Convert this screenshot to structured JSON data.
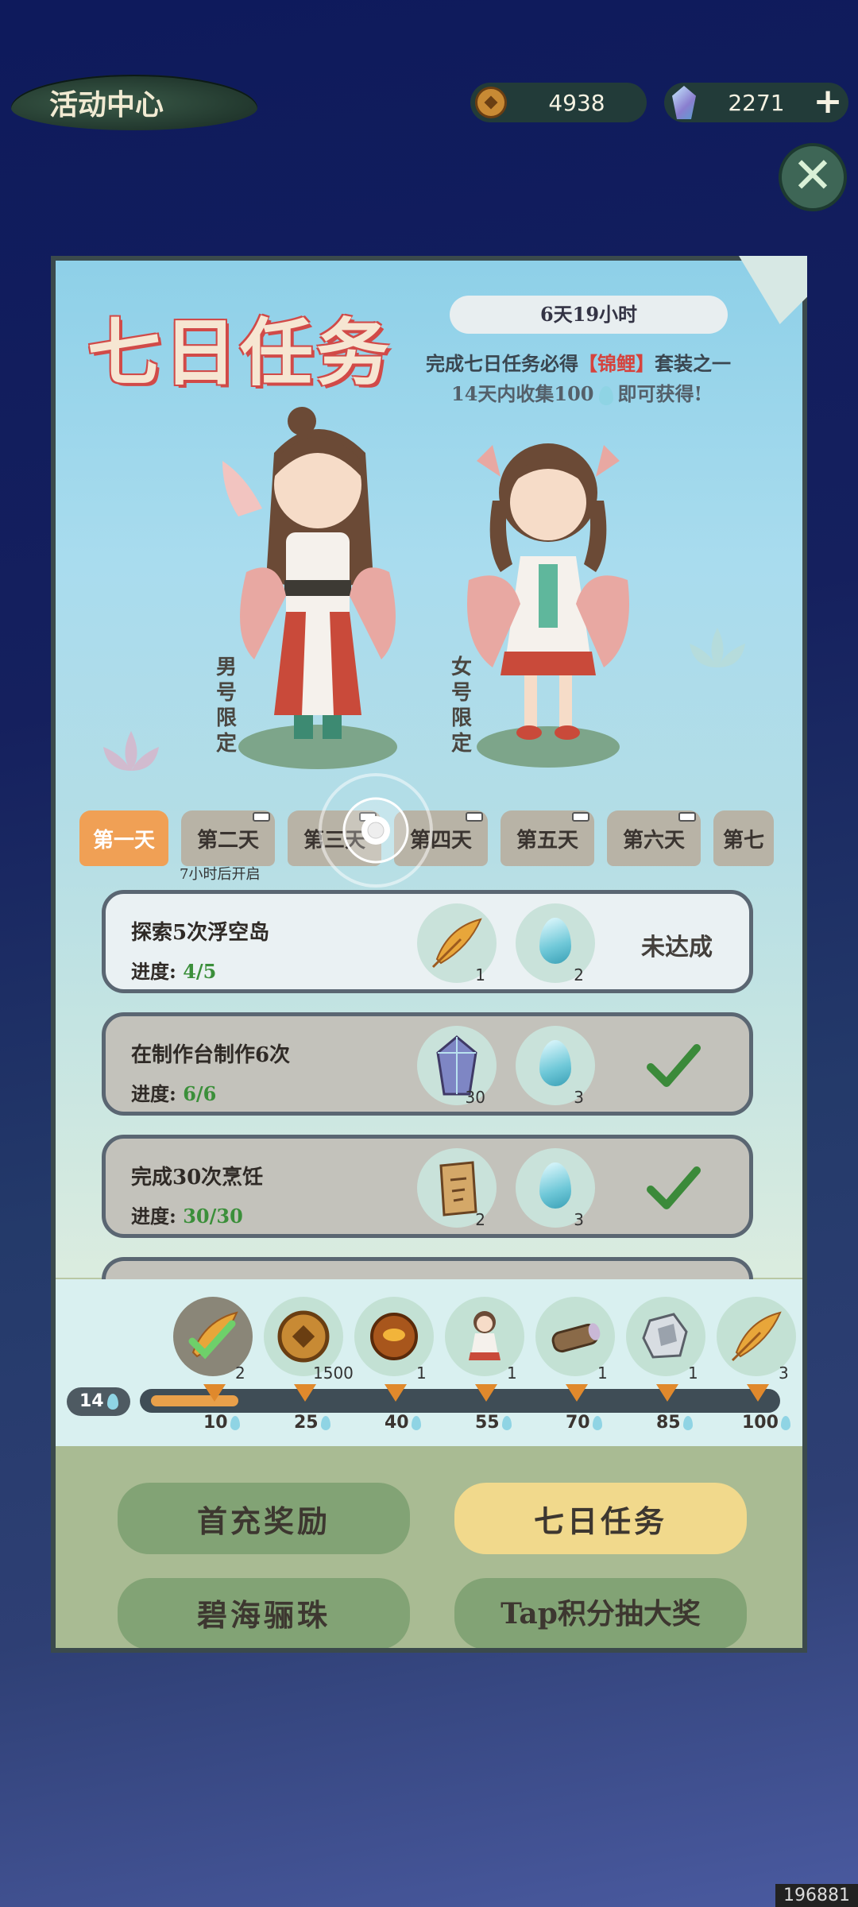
{
  "header": {
    "title": "活动中心",
    "coins": "4938",
    "gems": "2271",
    "plus": "+",
    "close": "✕"
  },
  "event": {
    "title": "七日任务",
    "timer": "6天19小时",
    "desc_prefix": "完成七日任务必得",
    "desc_highlight": "【锦鲤】",
    "desc_suffix": "套装之一",
    "desc2_prefix": "14天内收集100",
    "desc2_suffix": "即可获得!",
    "male_label": "男号限定",
    "female_label": "女号限定"
  },
  "tabs": [
    {
      "label": "第一天",
      "active": true
    },
    {
      "label": "第二天"
    },
    {
      "label": "第三天"
    },
    {
      "label": "第四天"
    },
    {
      "label": "第五天"
    },
    {
      "label": "第六天"
    },
    {
      "label": "第七"
    }
  ],
  "tab_note": "7小时后开启",
  "tasks": [
    {
      "name": "探索5次浮空岛",
      "progress_label": "进度:",
      "progress": "4/5",
      "rewards": [
        {
          "icon": "golden-feather-icon",
          "count": "1"
        },
        {
          "icon": "water-drop-icon",
          "count": "2"
        }
      ],
      "status": "未达成",
      "done": false
    },
    {
      "name": "在制作台制作6次",
      "progress_label": "进度:",
      "progress": "6/6",
      "rewards": [
        {
          "icon": "crystal-icon",
          "count": "30"
        },
        {
          "icon": "water-drop-icon",
          "count": "3"
        }
      ],
      "status": "check-icon",
      "done": true
    },
    {
      "name": "完成30次烹饪",
      "progress_label": "进度:",
      "progress": "30/30",
      "rewards": [
        {
          "icon": "scroll-icon",
          "count": "2"
        },
        {
          "icon": "water-drop-icon",
          "count": "3"
        }
      ],
      "status": "check-icon",
      "done": true
    }
  ],
  "milestones": {
    "current": "14",
    "max": 100,
    "items": [
      {
        "value": "10",
        "icon": "golden-feather-icon",
        "count": "2",
        "claimed": true
      },
      {
        "value": "25",
        "icon": "copper-coin-icon",
        "count": "1500"
      },
      {
        "value": "40",
        "icon": "amber-orb-icon",
        "count": "1"
      },
      {
        "value": "55",
        "icon": "doll-icon",
        "count": "1"
      },
      {
        "value": "70",
        "icon": "wood-log-icon",
        "count": "1"
      },
      {
        "value": "85",
        "icon": "silver-ore-icon",
        "count": "1"
      },
      {
        "value": "100",
        "icon": "golden-feather-icon",
        "count": "3"
      }
    ]
  },
  "bottom_buttons": [
    {
      "label": "首充奖励",
      "style": "green"
    },
    {
      "label": "七日任务",
      "style": "yellow"
    },
    {
      "label": "碧海骊珠",
      "style": "green"
    },
    {
      "label": "Tap积分抽大奖",
      "style": "green"
    }
  ],
  "watermark": "196881",
  "colors": {
    "accent": "#f0a055",
    "highlight_red": "#d6423c",
    "progress_green": "#3b8f3a"
  }
}
